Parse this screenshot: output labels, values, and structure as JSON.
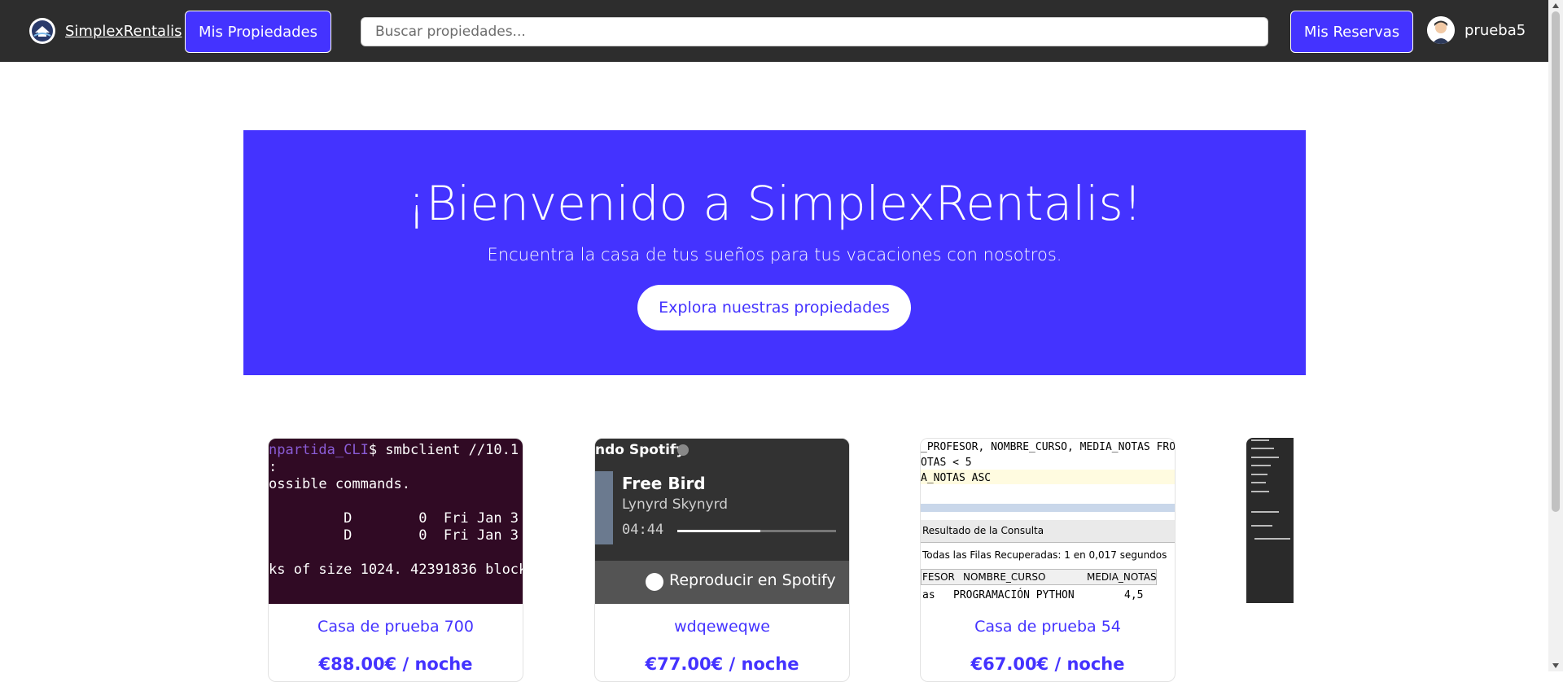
{
  "navbar": {
    "brand_name": "SimplexRentalis",
    "my_properties_label": "Mis Propiedades",
    "search_placeholder": "Buscar propiedades...",
    "my_bookings_label": "Mis Reservas",
    "username": "prueba5"
  },
  "hero": {
    "title": "¡Bienvenido a SimplexRentalis!",
    "subtitle": "Encuentra la casa de tus sueños para tus vacaciones con nosotros.",
    "cta_label": "Explora nuestras propiedades"
  },
  "properties": [
    {
      "title": "Casa de prueba 700",
      "price": "€88.00€ / noche",
      "image_text": {
        "line1_prompt": "npartida_CLI",
        "line1_cmd": "$ smbclient //10.1",
        "line2": "ossible commands.",
        "line3": "         D        0  Fri Jan 3",
        "line4": "         D        0  Fri Jan 3",
        "line5": "ks of size 1024. 42391836 block"
      }
    },
    {
      "title": "wdqeweqwe",
      "price": "€77.00€ / noche",
      "image_text": {
        "header": "ndo Spotify",
        "song": "Free Bird",
        "artist": "Lynyrd Skynyrd",
        "time": "04:44",
        "cta": "Reproducir en Spotify"
      }
    },
    {
      "title": "Casa de prueba 54",
      "price": "€67.00€ / noche",
      "image_text": {
        "line1": "_PROFESOR, NOMBRE_CURSO, MEDIA_NOTAS FRO",
        "line2": "OTAS < 5",
        "line3": "A_NOTAS ASC",
        "tab": "Resultado de la Consulta",
        "status": "Todas las Filas Recuperadas: 1 en 0,017 segundos",
        "col1": "FESOR",
        "col2": "NOMBRE_CURSO",
        "col3": "MEDIA_NOTAS",
        "cell1": "as",
        "cell2": "PROGRAMACIÓN PYTHON",
        "cell3": "4,5"
      }
    }
  ],
  "colors": {
    "accent": "#4433ff",
    "navbar_bg": "#2d2d2d"
  }
}
